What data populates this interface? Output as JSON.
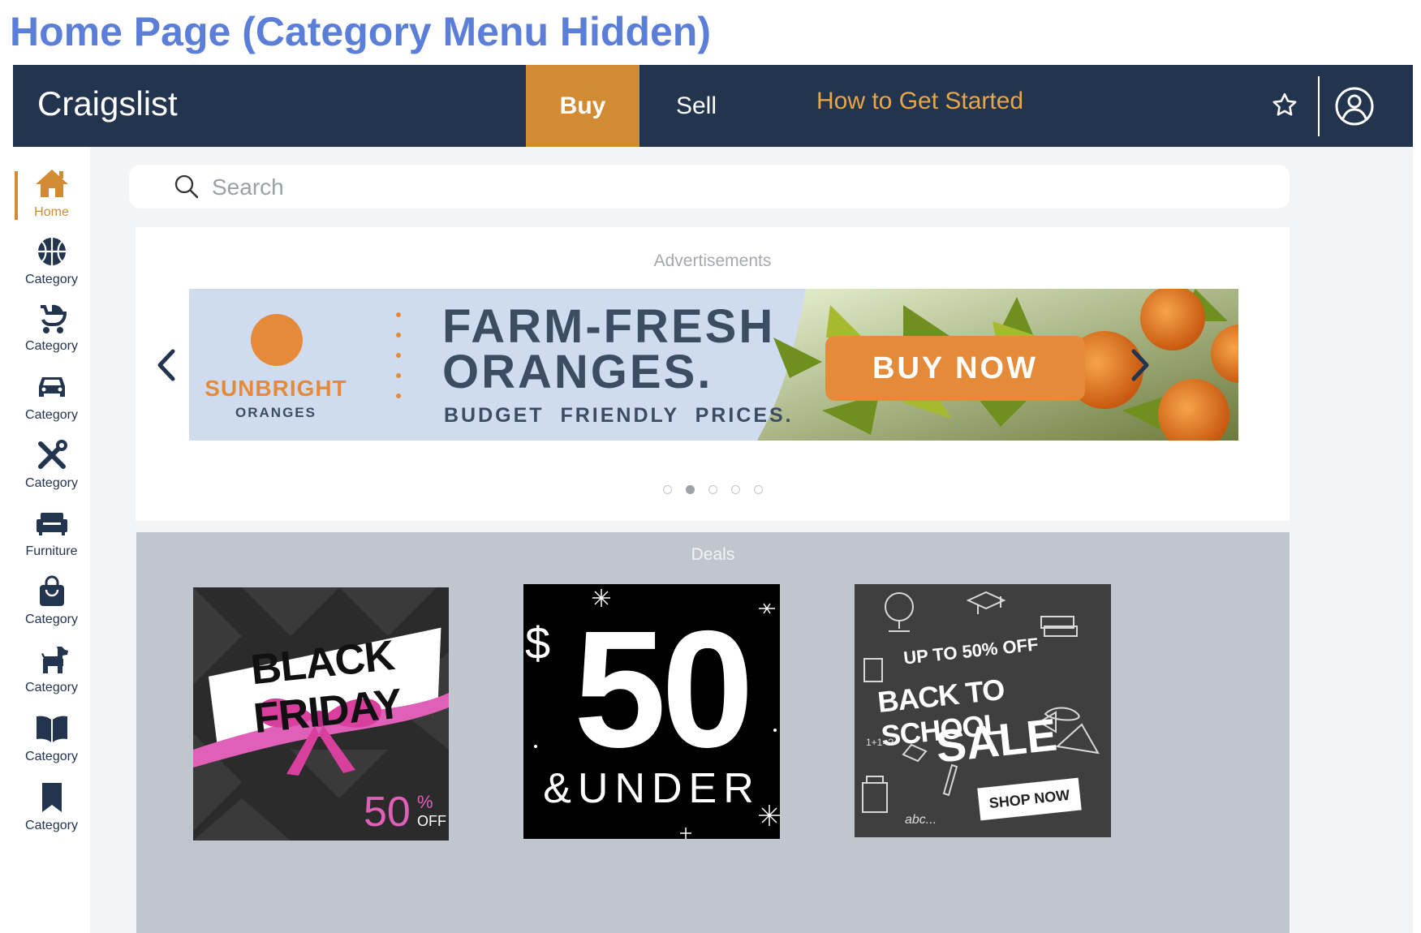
{
  "page_title": "Home Page (Category Menu Hidden)",
  "header": {
    "brand": "Craigslist",
    "nav": {
      "buy": "Buy",
      "sell": "Sell",
      "how": "How to Get Started"
    },
    "icons": [
      "star-icon",
      "user-account-icon"
    ]
  },
  "sidebar": {
    "items": [
      {
        "label": "Home",
        "icon": "home-icon",
        "active": true
      },
      {
        "label": "Category",
        "icon": "basketball-icon"
      },
      {
        "label": "Category",
        "icon": "stroller-icon"
      },
      {
        "label": "Category",
        "icon": "car-icon"
      },
      {
        "label": "Category",
        "icon": "tools-icon"
      },
      {
        "label": "Furniture",
        "icon": "sofa-icon"
      },
      {
        "label": "Category",
        "icon": "shopping-bag-icon"
      },
      {
        "label": "Category",
        "icon": "dog-icon"
      },
      {
        "label": "Category",
        "icon": "book-icon"
      },
      {
        "label": "Category",
        "icon": "bookmark-icon"
      }
    ]
  },
  "search": {
    "placeholder": "Search"
  },
  "ads": {
    "title": "Advertisements",
    "banner": {
      "brand": "SUNBRIGHT",
      "brand_sub": "ORANGES",
      "headline_1": "FARM-FRESH",
      "headline_2": "ORANGES.",
      "tagline": "BUDGET  FRIENDLY  PRICES.",
      "cta": "BUY NOW"
    },
    "carousel_pages": 5,
    "current_page": 2
  },
  "deals": {
    "title": "Deals",
    "cards": [
      {
        "headline": "BLACK FRIDAY",
        "percent": "50",
        "percent_sign": "%",
        "off": "OFF"
      },
      {
        "currency": "$",
        "amount": "50",
        "sub": "&UNDER"
      },
      {
        "top": "UP TO 50% OFF",
        "headline": "BACK TO SCHOOL",
        "sale": "SALE",
        "cta": "SHOP NOW",
        "doodle_1": "1+1=?",
        "doodle_2": "abc..."
      }
    ]
  },
  "colors": {
    "header_bg": "#23344f",
    "accent": "#d28a33",
    "title_blue": "#5b7fd9",
    "deals_bg": "#c0c6ce"
  }
}
